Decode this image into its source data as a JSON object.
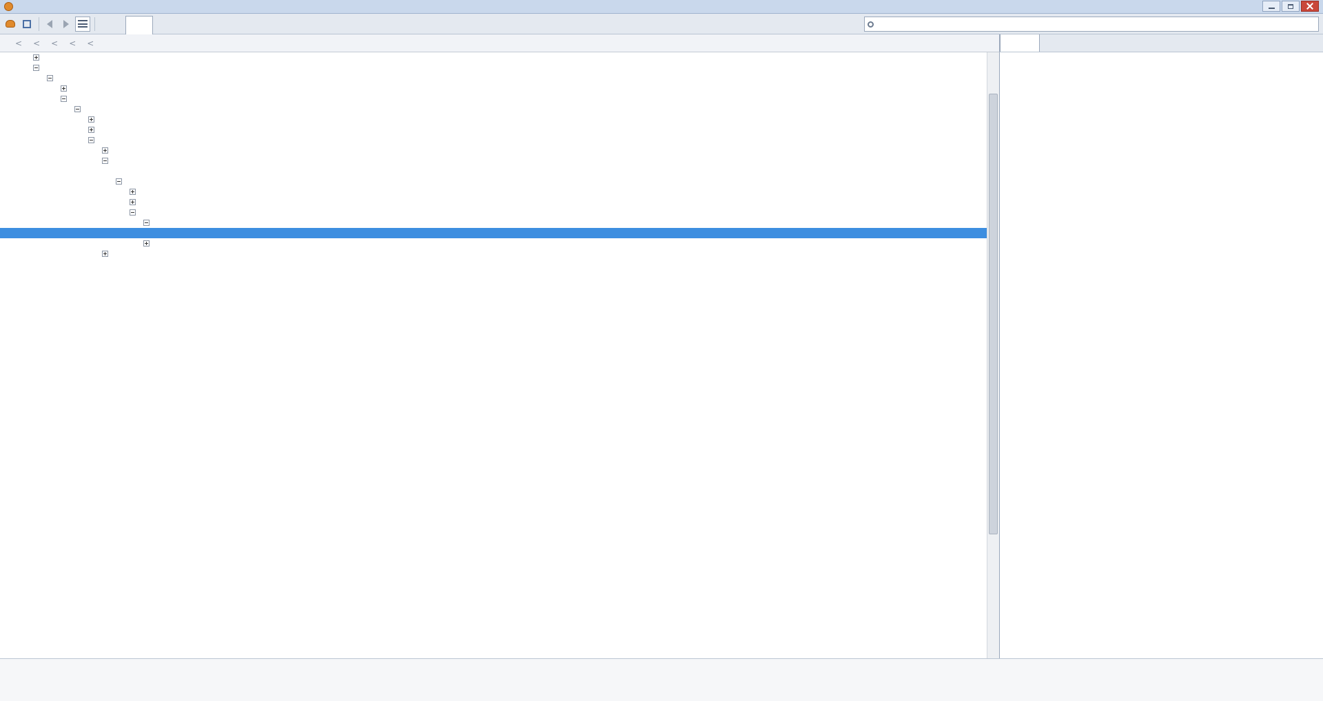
{
  "window": {
    "title": ""
  },
  "toolbar": {
    "tabs": [
      {
        "label": ""
      },
      {
        "label": ""
      },
      {
        "label": ""
      },
      {
        "label": ""
      },
      {
        "label": ""
      },
      {
        "label": ""
      },
      {
        "label": ""
      }
    ],
    "search_placeholder": ""
  },
  "breadcrumb": {
    "items": [
      {
        "label": ""
      },
      {
        "label": ""
      },
      {
        "label": ""
      },
      {
        "label": ""
      },
      {
        "label": ""
      },
      {
        "label": ""
      }
    ]
  },
  "html_tree": {
    "rows": [
      {
        "text": ""
      },
      {
        "text": ""
      },
      {
        "text": ""
      },
      {
        "text": ""
      },
      {
        "text": ""
      },
      {
        "text": ""
      },
      {
        "text": ""
      },
      {
        "text": ""
      },
      {
        "text": ""
      },
      {
        "text": ""
      },
      {
        "text": ""
      },
      {
        "text": ""
      },
      {
        "text": ""
      },
      {
        "text": ""
      },
      {
        "text": ""
      },
      {
        "text": ""
      },
      {
        "text": ""
      },
      {
        "text": ""
      },
      {
        "text": ""
      },
      {
        "text": ""
      }
    ]
  },
  "side_panel": {
    "tabs": [
      {
        "label": ""
      },
      {
        "label": ""
      },
      {
        "label": ""
      },
      {
        "label": ""
      }
    ],
    "lines": [
      {
        "text": ""
      },
      {
        "text": ""
      },
      {
        "text": ""
      },
      {
        "text": ""
      },
      {
        "text": ""
      },
      {
        "text": ""
      },
      {
        "text": ""
      },
      {
        "text": ""
      },
      {
        "text": ""
      },
      {
        "text": ""
      }
    ]
  },
  "command_line": {
    "prompt": "",
    "value": ""
  }
}
